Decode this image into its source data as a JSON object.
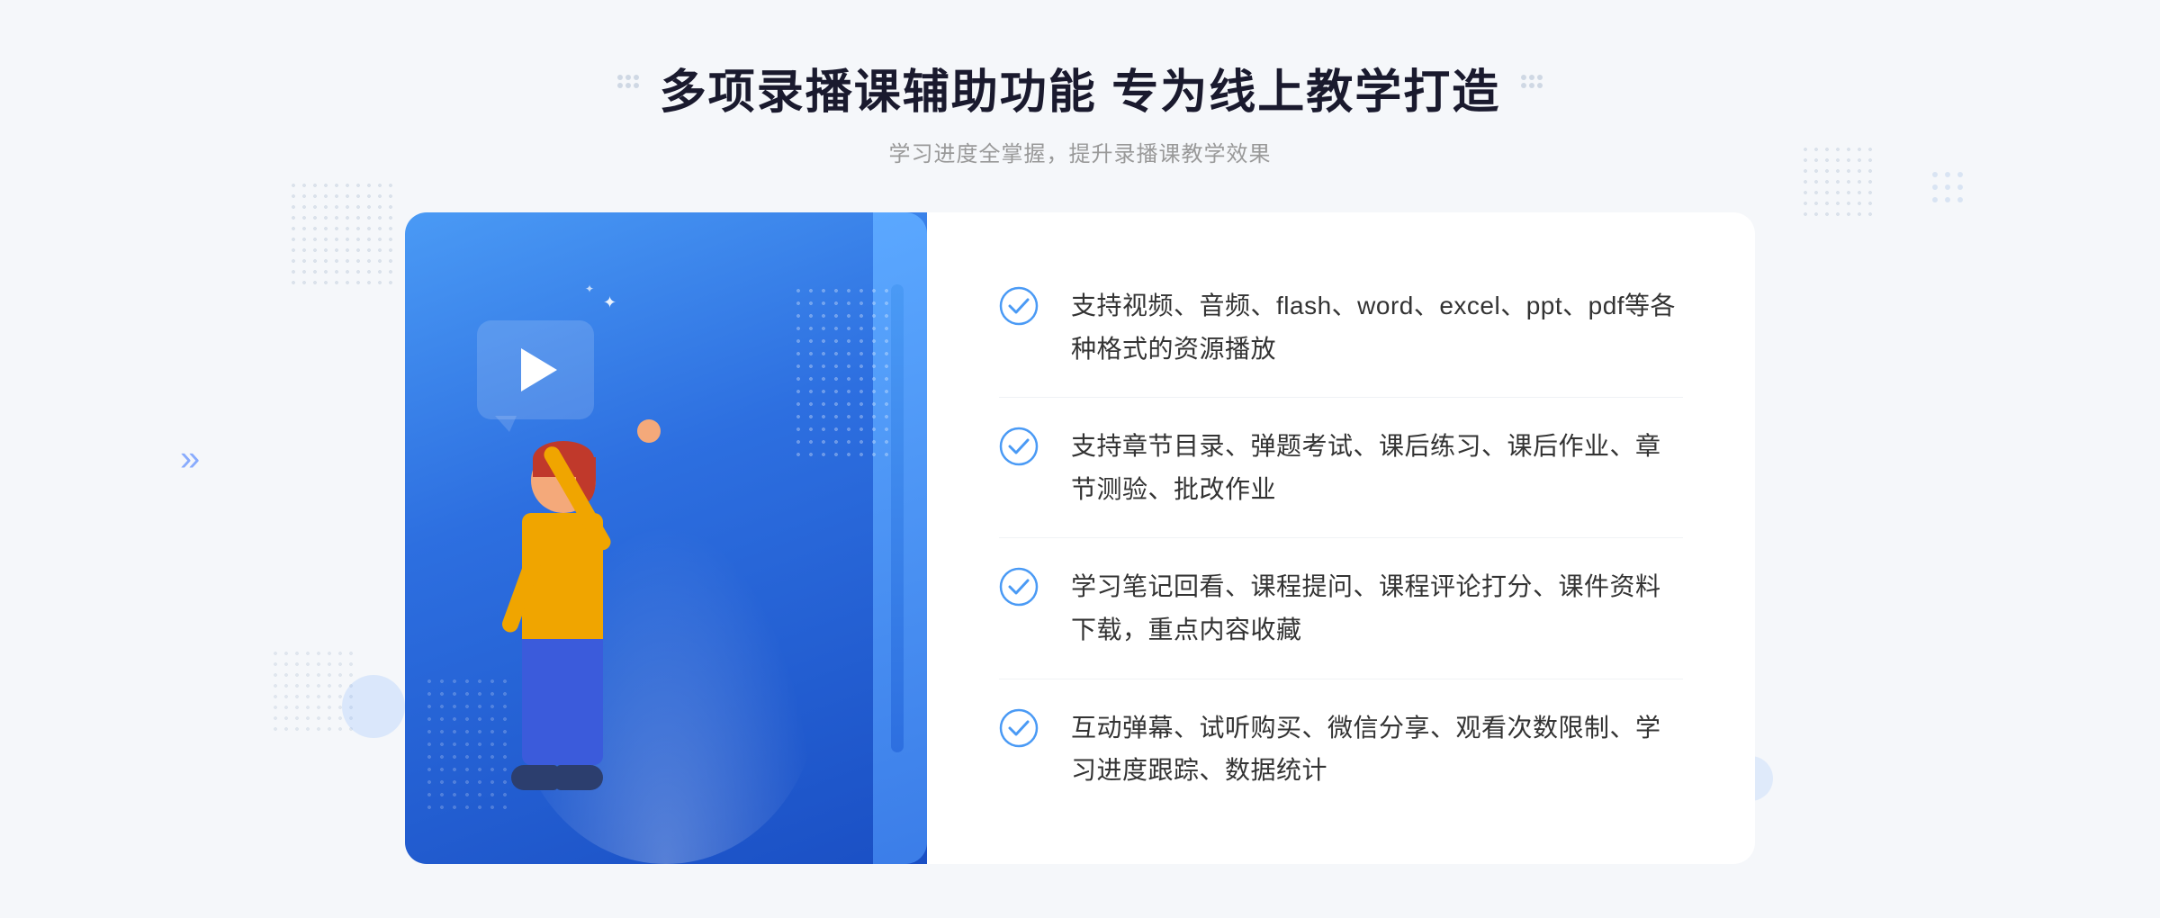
{
  "header": {
    "decoration_left": "∷",
    "decoration_right": "∷",
    "main_title": "多项录播课辅助功能 专为线上教学打造",
    "subtitle": "学习进度全掌握，提升录播课教学效果"
  },
  "features": [
    {
      "id": 1,
      "text": "支持视频、音频、flash、word、excel、ppt、pdf等各种格式的资源播放"
    },
    {
      "id": 2,
      "text": "支持章节目录、弹题考试、课后练习、课后作业、章节测验、批改作业"
    },
    {
      "id": 3,
      "text": "学习笔记回看、课程提问、课程评论打分、课件资料下载，重点内容收藏"
    },
    {
      "id": 4,
      "text": "互动弹幕、试听购买、微信分享、观看次数限制、学习进度跟踪、数据统计"
    }
  ],
  "arrows": {
    "left": "»",
    "right": "∷"
  },
  "colors": {
    "primary_blue": "#3b7de8",
    "light_blue": "#4a9af5",
    "accent": "#5b8cff",
    "text_dark": "#1a1a2e",
    "text_gray": "#999999",
    "check_color": "#4a9af5"
  }
}
